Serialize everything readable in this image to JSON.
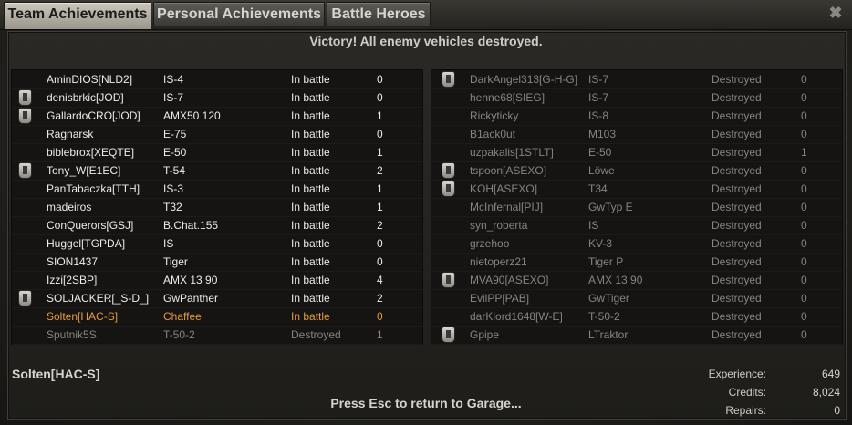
{
  "tabs": [
    {
      "label": "Team Achievements"
    },
    {
      "label": "Personal Achievements"
    },
    {
      "label": "Battle Heroes"
    }
  ],
  "close_glyph": "✖",
  "result": "Victory! All enemy vehicles destroyed.",
  "left_team": [
    {
      "badge": false,
      "name": "AminDIOS[NLD2]",
      "tank": "IS-4",
      "status": "In battle",
      "frags": "0",
      "state": "alive"
    },
    {
      "badge": true,
      "name": "denisbrkic[JOD]",
      "tank": "IS-7",
      "status": "In battle",
      "frags": "0",
      "state": "alive"
    },
    {
      "badge": true,
      "name": "GallardoCRO[JOD]",
      "tank": "AMX50 120",
      "status": "In battle",
      "frags": "1",
      "state": "alive"
    },
    {
      "badge": false,
      "name": "Ragnarsk",
      "tank": "E-75",
      "status": "In battle",
      "frags": "0",
      "state": "alive"
    },
    {
      "badge": false,
      "name": "biblebrox[XEQTE]",
      "tank": "E-50",
      "status": "In battle",
      "frags": "1",
      "state": "alive"
    },
    {
      "badge": true,
      "name": "Tony_W[E1EC]",
      "tank": "T-54",
      "status": "In battle",
      "frags": "2",
      "state": "alive"
    },
    {
      "badge": false,
      "name": "PanTabaczka[TTH]",
      "tank": "IS-3",
      "status": "In battle",
      "frags": "1",
      "state": "alive"
    },
    {
      "badge": false,
      "name": "madeiros",
      "tank": "T32",
      "status": "In battle",
      "frags": "1",
      "state": "alive"
    },
    {
      "badge": false,
      "name": "ConQuerors[GSJ]",
      "tank": "B.Chat.155",
      "status": "In battle",
      "frags": "2",
      "state": "alive"
    },
    {
      "badge": false,
      "name": "Huggel[TGPDA]",
      "tank": "IS",
      "status": "In battle",
      "frags": "0",
      "state": "alive"
    },
    {
      "badge": false,
      "name": "SION1437",
      "tank": "Tiger",
      "status": "In battle",
      "frags": "0",
      "state": "alive"
    },
    {
      "badge": false,
      "name": "Izzi[2SBP]",
      "tank": "AMX 13 90",
      "status": "In battle",
      "frags": "4",
      "state": "alive"
    },
    {
      "badge": true,
      "name": "SOLJACKER[_S-D_]",
      "tank": "GwPanther",
      "status": "In battle",
      "frags": "2",
      "state": "alive"
    },
    {
      "badge": false,
      "name": "Solten[HAC-S]",
      "tank": "Chaffee",
      "status": "In battle",
      "frags": "0",
      "state": "player"
    },
    {
      "badge": false,
      "name": "Sputnik5S",
      "tank": "T-50-2",
      "status": "Destroyed",
      "frags": "1",
      "state": "dead"
    }
  ],
  "right_team": [
    {
      "badge": true,
      "name": "DarkAngel313[G-H-G]",
      "tank": "IS-7",
      "status": "Destroyed",
      "frags": "0",
      "state": "dead"
    },
    {
      "badge": false,
      "name": "henne68[SIEG]",
      "tank": "IS-7",
      "status": "Destroyed",
      "frags": "0",
      "state": "dead"
    },
    {
      "badge": false,
      "name": "Rickyticky",
      "tank": "IS-8",
      "status": "Destroyed",
      "frags": "0",
      "state": "dead"
    },
    {
      "badge": false,
      "name": "B1ack0ut",
      "tank": "M103",
      "status": "Destroyed",
      "frags": "0",
      "state": "dead"
    },
    {
      "badge": false,
      "name": "uzpakalis[1STLT]",
      "tank": "E-50",
      "status": "Destroyed",
      "frags": "1",
      "state": "dead"
    },
    {
      "badge": true,
      "name": "tspoon[ASEXO]",
      "tank": "Löwe",
      "status": "Destroyed",
      "frags": "0",
      "state": "dead"
    },
    {
      "badge": true,
      "name": "KOH[ASEXO]",
      "tank": "T34",
      "status": "Destroyed",
      "frags": "0",
      "state": "dead"
    },
    {
      "badge": false,
      "name": "McInfernal[PIJ]",
      "tank": "GwTyp E",
      "status": "Destroyed",
      "frags": "0",
      "state": "dead"
    },
    {
      "badge": false,
      "name": "syn_roberta",
      "tank": "IS",
      "status": "Destroyed",
      "frags": "0",
      "state": "dead"
    },
    {
      "badge": false,
      "name": "grzehoo",
      "tank": "KV-3",
      "status": "Destroyed",
      "frags": "0",
      "state": "dead"
    },
    {
      "badge": false,
      "name": "nietoperz21",
      "tank": "Tiger P",
      "status": "Destroyed",
      "frags": "0",
      "state": "dead"
    },
    {
      "badge": true,
      "name": "MVA90[ASEXO]",
      "tank": "AMX 13 90",
      "status": "Destroyed",
      "frags": "0",
      "state": "dead"
    },
    {
      "badge": false,
      "name": "EvilPP[PAB]",
      "tank": "GwTiger",
      "status": "Destroyed",
      "frags": "0",
      "state": "dead"
    },
    {
      "badge": false,
      "name": "darKlord1648[W-E]",
      "tank": "T-50-2",
      "status": "Destroyed",
      "frags": "0",
      "state": "dead"
    },
    {
      "badge": true,
      "name": "Gpipe",
      "tank": "LTraktor",
      "status": "Destroyed",
      "frags": "0",
      "state": "dead"
    }
  ],
  "player_name": "Solten[HAC-S]",
  "stats": [
    {
      "label": "Experience:",
      "value": "649"
    },
    {
      "label": "Credits:",
      "value": "8,024"
    },
    {
      "label": "Repairs:",
      "value": "0"
    }
  ],
  "footer": "Press Esc to return to Garage..."
}
